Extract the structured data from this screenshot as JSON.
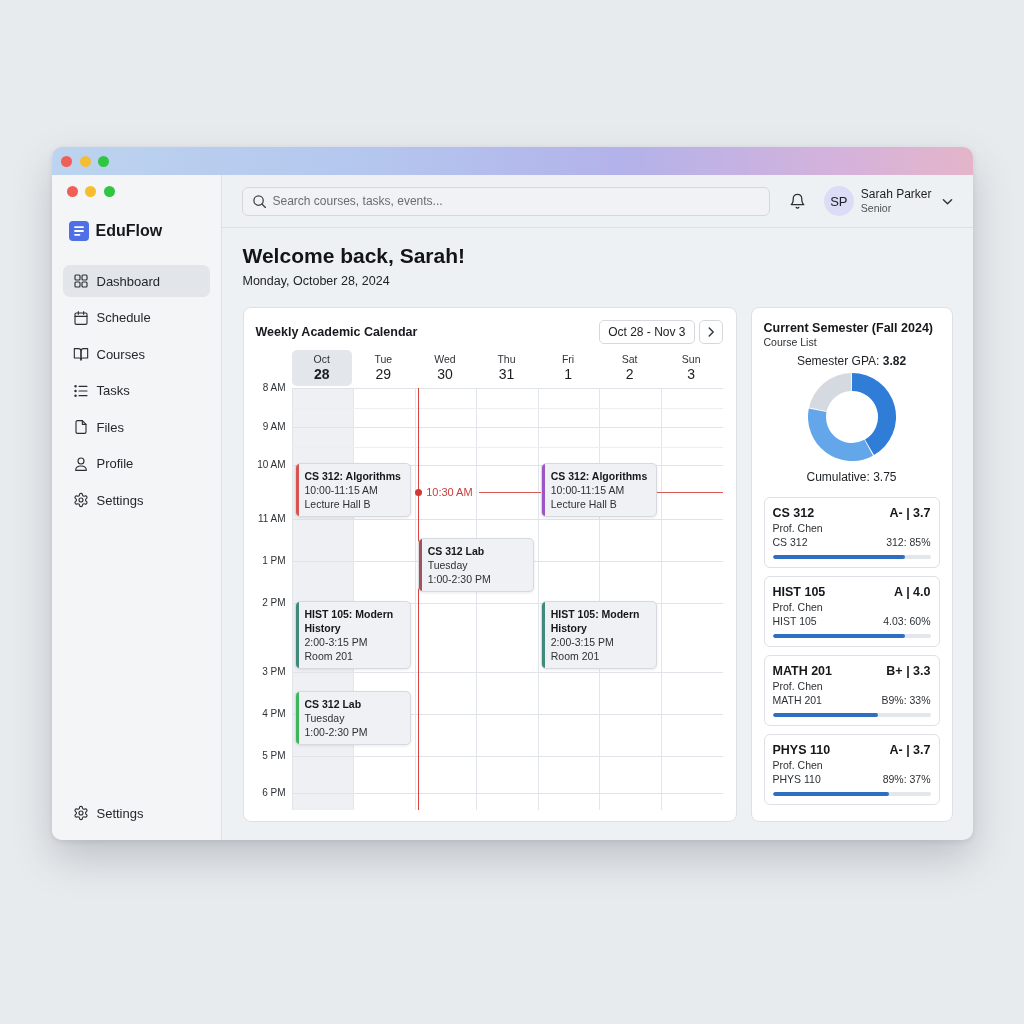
{
  "sidebar": {
    "app_name": "EduFlow",
    "items": [
      {
        "label": "Dashboard",
        "kind": "grid",
        "selected": true
      },
      {
        "label": "Schedule",
        "kind": "calendar",
        "selected": false
      },
      {
        "label": "Courses",
        "kind": "book",
        "selected": false
      },
      {
        "label": "Tasks",
        "kind": "list",
        "selected": false
      },
      {
        "label": "Files",
        "kind": "file",
        "selected": false
      },
      {
        "label": "Profile",
        "kind": "person",
        "selected": false
      },
      {
        "label": "Settings",
        "kind": "gear",
        "selected": false
      }
    ],
    "footer_item": {
      "label": "Settings",
      "kind": "gear"
    }
  },
  "header": {
    "search": {
      "placeholder": "Search courses, tasks, events..."
    },
    "user": {
      "initials": "SP",
      "name": "Sarah Parker",
      "role": "Senior"
    }
  },
  "welcome": {
    "title": "Welcome back, Sarah!",
    "date": "Monday, October 28, 2024"
  },
  "calendar": {
    "title": "Weekly Academic Calendar",
    "range": "Oct 28 - Nov 3",
    "days": [
      {
        "label": "Oct",
        "date": "28",
        "selected": true
      },
      {
        "label": "Tue",
        "date": "29",
        "selected": false
      },
      {
        "label": "Wed",
        "date": "30",
        "selected": false
      },
      {
        "label": "Thu",
        "date": "31",
        "selected": false
      },
      {
        "label": "Fri",
        "date": "1",
        "selected": false
      },
      {
        "label": "Sat",
        "date": "2",
        "selected": false
      },
      {
        "label": "Sun",
        "date": "3",
        "selected": false
      }
    ],
    "hours": [
      {
        "label": "8 AM"
      },
      {
        "label": "9 AM"
      },
      {
        "label": "10 AM",
        "cells": [
          {
            "event": {
              "title": "CS 312: Algorithms",
              "details": [
                "10:00-11:15 AM",
                "Lecture Hall B"
              ],
              "color": "#d9534f",
              "mid_hour": false
            }
          },
          null,
          {
            "now": {
              "label": "10:30 AM",
              "mid_hour": true
            }
          },
          null,
          {
            "event": {
              "title": "CS 312: Algorithms",
              "details": [
                "10:00-11:15 AM",
                "Lecture Hall B"
              ],
              "color": "#9b55c4",
              "mid_hour": false
            }
          }
        ]
      },
      {
        "label": "11 AM",
        "cells": [
          null,
          null,
          {
            "event": {
              "title": "CS 312 Lab",
              "details": [
                "Tuesday",
                "1:00-2:30 PM"
              ],
              "color": "#a4515e",
              "mid_hour": true
            }
          }
        ]
      },
      {
        "label": "1 PM"
      },
      {
        "label": "2 PM",
        "cells": [
          {
            "event": {
              "title": "HIST 105: Modern History",
              "details": [
                "2:00-3:15 PM",
                "Room 201"
              ],
              "color": "#3f8a7c",
              "mid_hour": false
            }
          },
          null,
          null,
          null,
          {
            "event": {
              "title": "HIST 105: Modern History",
              "details": [
                "2:00-3:15 PM",
                "Room 201"
              ],
              "color": "#3f8a7d",
              "mid_hour": false
            }
          }
        ]
      },
      {
        "label": "3 PM",
        "cells": [
          {
            "event": {
              "title": "CS 312 Lab",
              "details": [
                "Tuesday",
                "1:00-2:30 PM"
              ],
              "color": "#3cb85a",
              "mid_hour": true
            }
          }
        ]
      },
      {
        "label": "4 PM"
      },
      {
        "label": "5 PM"
      },
      {
        "label": "6 PM"
      }
    ]
  },
  "semester": {
    "title": "Current Semester (Fall 2024)",
    "subtitle": "Course List",
    "gpa": "Semester GPA: **3.82**",
    "cumulative": "Cumulative: 3.75",
    "courses": [
      {
        "code": "CS 312",
        "grade": "A- | 3.7",
        "professor": "Prof. Chen",
        "label": "CS 312",
        "progress": "312: 85%",
        "level": 0.84
      },
      {
        "code": "HIST 105",
        "grade": "A | 4.0",
        "professor": "Prof. Chen",
        "label": "HIST 105",
        "progress": "4.03: 60%",
        "level": 0.84
      },
      {
        "code": "MATH 201",
        "grade": "B+ | 3.3",
        "professor": "Prof. Chen",
        "label": "MATH 201",
        "progress": "B9%: 33%",
        "level": 0.67
      },
      {
        "code": "PHYS 110",
        "grade": "A- | 3.7",
        "professor": "Prof. Chen",
        "label": "PHYS 110",
        "progress": "89%: 37%",
        "level": 0.74
      }
    ]
  }
}
